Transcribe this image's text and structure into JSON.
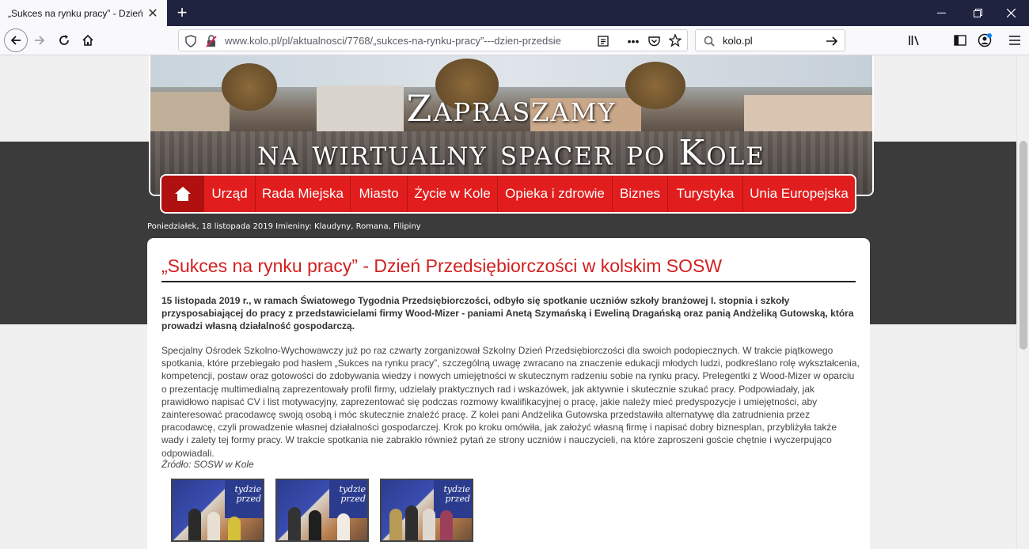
{
  "browser": {
    "tab_title": "„Sukces na rynku pracy” - Dzień Prz",
    "url": "www.kolo.pl/pl/aktualnosci/7768/„sukces-na-rynku-pracy”---dzien-przedsie",
    "search_value": "kolo.pl"
  },
  "banner": {
    "line1": "Zapraszamy",
    "line2": "na wirtualny spacer po Kole"
  },
  "menu": {
    "items": [
      "Urząd",
      "Rada Miejska",
      "Miasto",
      "Życie w Kole",
      "Opieka i zdrowie",
      "Biznes",
      "Turystyka",
      "Unia Europejska"
    ]
  },
  "dateline": "Poniedziałek, 18 listopada 2019   Imieniny: Klaudyny, Romana, Filipiny",
  "article": {
    "title": "„Sukces na rynku pracy” - Dzień Przedsiębiorczości w kolskim SOSW",
    "lead": "15 listopada 2019 r., w ramach Światowego Tygodnia Przedsiębiorczości, odbyło się spotkanie uczniów szkoły branżowej I. stopnia i szkoły przysposabiającej do pracy  z przedstawicielami firmy Wood-Mizer - paniami Anetą Szymańską i Eweliną Dragańską oraz panią Andżeliką Gutowską, która prowadzi własną działalność gospodarczą.",
    "body": "Specjalny Ośrodek Szkolno-Wychowawczy już po raz czwarty zorganizował Szkolny Dzień Przedsiębiorczości dla swoich podopiecznych.  W trakcie piątkowego spotkania, które przebiegało pod hasłem „Sukces na rynku pracy”, szczególną uwagę zwracano na znaczenie edukacji młodych ludzi, podkreślano rolę wykształcenia, kompetencji, postaw oraz gotowości do zdobywania wiedzy i nowych umiejętności w skutecznym radzeniu sobie na rynku pracy. Prelegentki z Wood-Mizer w oparciu o prezentację multimedialną zaprezentowały profil firmy, udzielały praktycznych rad i wskazówek, jak aktywnie i skutecznie szukać pracy. Podpowiadały, jak prawidłowo napisać CV i list motywacyjny,  zaprezentować się podczas rozmowy kwalifikacyjnej o pracę, jakie należy mieć predyspozycje i umiejętności, aby zainteresować pracodawcę swoją osobą i móc skutecznie znaleźć pracę. Z kolei pani Andżelika Gutowska przedstawiła alternatywę dla zatrudnienia przez pracodawcę, czyli prowadzenie własnej działalności gospodarczej. Krok po kroku omówiła, jak założyć własną firmę i napisać dobry biznesplan, przybliżyła także wady i zalety tej formy pracy.  W trakcie spotkania nie zabrakło również pytań  ze strony uczniów i nauczycieli, na które zaproszeni goście chętnie  i wyczerpująco odpowiadali.",
    "source": "Źródło: SOSW w Kole",
    "thumb_text": "tydzie przed"
  },
  "colors": {
    "menu_red": "#e21d1d",
    "title_red": "#d21f1f",
    "tabbar": "#202340"
  }
}
